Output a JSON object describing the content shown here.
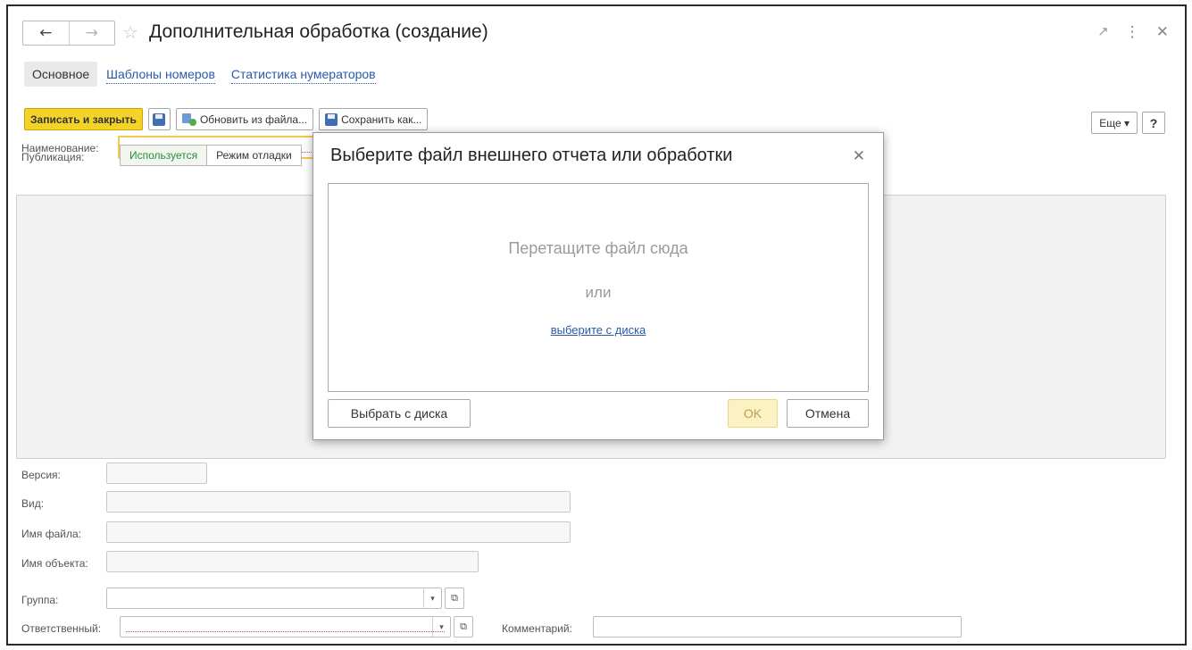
{
  "window": {
    "title": "Дополнительная обработка (создание)",
    "nav_back": "←",
    "nav_forward": "→",
    "star": "☆",
    "link_icon": "🔗",
    "menu_icon": "⋮",
    "close_icon": "✕"
  },
  "tabs": [
    {
      "label": "Основное"
    },
    {
      "label": "Шаблоны номеров"
    },
    {
      "label": "Статистика нумераторов"
    }
  ],
  "toolbar": {
    "save_close": "Записать и закрыть",
    "refresh_from_file": "Обновить из файла...",
    "save_as": "Сохранить как...",
    "more": "Еще ▾",
    "help": "?"
  },
  "form": {
    "name_label": "Наименование:",
    "publication_label": "Публикация:",
    "publication_options": [
      "Используется",
      "Режим отладки"
    ],
    "version_label": "Версия:",
    "kind_label": "Вид:",
    "file_name_label": "Имя файла:",
    "object_name_label": "Имя объекта:",
    "group_label": "Группа:",
    "responsible_label": "Ответственный:",
    "comment_label": "Комментарий:",
    "dropdown_glyph": "▾",
    "open_glyph": "⧉"
  },
  "dialog": {
    "title": "Выберите файл внешнего отчета или обработки",
    "close_glyph": "✕",
    "drop_hint": "Перетащите файл сюда",
    "or_text": "или",
    "choose_link": "выберите с диска",
    "choose_button": "Выбрать с диска",
    "ok_button": "OK",
    "cancel_button": "Отмена"
  },
  "colors": {
    "primary_button": "#f4d329",
    "link": "#2a5aa8",
    "active_option": "#2d8a3a",
    "required_underline": "#e04646"
  }
}
